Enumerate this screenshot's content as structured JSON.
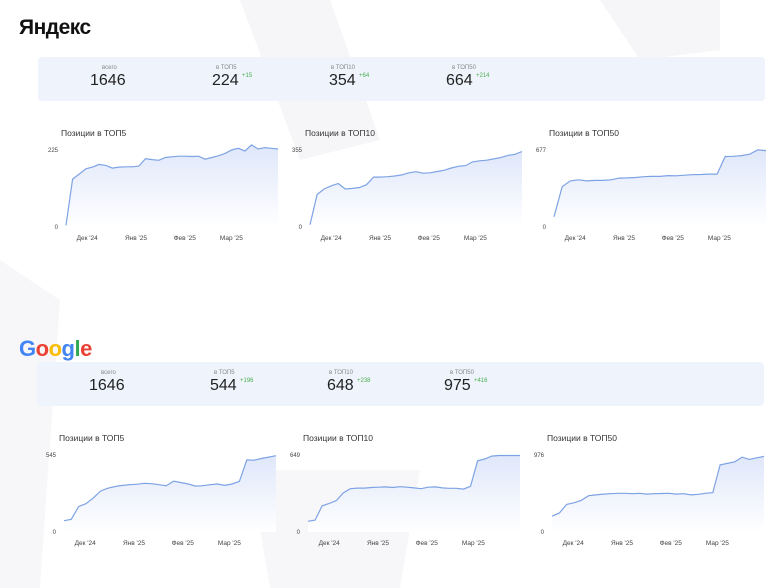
{
  "yandex": {
    "logo_text": "Яндекс",
    "stats": [
      {
        "caption": "всего",
        "value": "1646",
        "delta": ""
      },
      {
        "caption": "в ТОП5",
        "value": "224",
        "delta": "+15"
      },
      {
        "caption": "в ТОП10",
        "value": "354",
        "delta": "+64"
      },
      {
        "caption": "в ТОП50",
        "value": "664",
        "delta": "+214"
      }
    ]
  },
  "google": {
    "logo_letters": [
      {
        "char": "G",
        "color": "#4285F4"
      },
      {
        "char": "o",
        "color": "#EA4335"
      },
      {
        "char": "o",
        "color": "#FBBC05"
      },
      {
        "char": "g",
        "color": "#4285F4"
      },
      {
        "char": "l",
        "color": "#34A853"
      },
      {
        "char": "e",
        "color": "#EA4335"
      }
    ],
    "stats": [
      {
        "caption": "всего",
        "value": "1646",
        "delta": ""
      },
      {
        "caption": "в ТОП5",
        "value": "544",
        "delta": "+196"
      },
      {
        "caption": "в ТОП10",
        "value": "648",
        "delta": "+238"
      },
      {
        "caption": "в ТОП50",
        "value": "975",
        "delta": "+416"
      }
    ]
  },
  "colors": {
    "line": "#7ea3e4",
    "fill_top": "#dfe7fa",
    "fill_bottom": "#ffffff",
    "delta": "#4caf50"
  },
  "chart_data": [
    {
      "id": "yandex-top5",
      "type": "area",
      "title": "Позиции в ТОП5",
      "ylim": [
        0,
        225
      ],
      "y_ticks": [
        "0",
        "225"
      ],
      "x_ticks": [
        "Дек '24",
        "Янв '25",
        "Фев '25",
        "Мар '25"
      ],
      "x_tick_pos": [
        0.1,
        0.33,
        0.56,
        0.78
      ],
      "values": [
        5,
        140,
        155,
        170,
        175,
        183,
        180,
        172,
        175,
        176,
        176,
        178,
        200,
        197,
        195,
        203,
        205,
        207,
        207,
        206,
        207,
        198,
        203,
        208,
        215,
        225,
        230,
        222,
        240,
        228,
        232,
        230,
        228
      ]
    },
    {
      "id": "yandex-top10",
      "type": "area",
      "title": "Позиции в ТОП10",
      "ylim": [
        0,
        355
      ],
      "y_ticks": [
        "0",
        "355"
      ],
      "x_ticks": [
        "Дек '24",
        "Янв '25",
        "Фев '25",
        "Мар '25"
      ],
      "x_tick_pos": [
        0.1,
        0.33,
        0.56,
        0.78
      ],
      "values": [
        10,
        150,
        175,
        190,
        200,
        175,
        178,
        182,
        195,
        230,
        230,
        232,
        235,
        240,
        250,
        255,
        248,
        250,
        256,
        262,
        272,
        280,
        283,
        300,
        305,
        308,
        314,
        320,
        330,
        335,
        348
      ]
    },
    {
      "id": "yandex-top50",
      "type": "area",
      "title": "Позиции в ТОП50",
      "ylim": [
        0,
        677
      ],
      "y_ticks": [
        "0",
        "677"
      ],
      "x_ticks": [
        "Дек '24",
        "Янв '25",
        "Фев '25",
        "Мар '25"
      ],
      "x_tick_pos": [
        0.1,
        0.33,
        0.56,
        0.78
      ],
      "values": [
        90,
        355,
        405,
        415,
        405,
        410,
        410,
        415,
        430,
        432,
        435,
        442,
        445,
        445,
        452,
        450,
        455,
        460,
        462,
        465,
        465,
        620,
        622,
        628,
        640,
        678,
        672
      ]
    },
    {
      "id": "google-top5",
      "type": "area",
      "title": "Позиции в ТОП5",
      "ylim": [
        0,
        545
      ],
      "y_ticks": [
        "0",
        "545"
      ],
      "x_ticks": [
        "Дек '24",
        "Янв '25",
        "Фев '25",
        "Мар '25"
      ],
      "x_tick_pos": [
        0.1,
        0.33,
        0.56,
        0.78
      ],
      "values": [
        80,
        90,
        180,
        200,
        240,
        290,
        310,
        322,
        330,
        335,
        338,
        345,
        342,
        335,
        328,
        360,
        350,
        340,
        325,
        328,
        335,
        340,
        330,
        340,
        358,
        510,
        508,
        520,
        530,
        540
      ]
    },
    {
      "id": "google-top10",
      "type": "area",
      "title": "Позиции в ТОП10",
      "ylim": [
        0,
        649
      ],
      "y_ticks": [
        "0",
        "649"
      ],
      "x_ticks": [
        "Дек '24",
        "Янв '25",
        "Фев '25",
        "Мар '25"
      ],
      "x_tick_pos": [
        0.1,
        0.33,
        0.56,
        0.78
      ],
      "values": [
        90,
        100,
        220,
        240,
        265,
        330,
        365,
        370,
        370,
        375,
        378,
        380,
        375,
        382,
        378,
        372,
        365,
        378,
        380,
        372,
        368,
        368,
        362,
        385,
        600,
        615,
        640,
        645,
        645,
        645,
        645
      ]
    },
    {
      "id": "google-top50",
      "type": "area",
      "title": "Позиции в ТОП50",
      "ylim": [
        0,
        976
      ],
      "y_ticks": [
        "0",
        "976"
      ],
      "x_ticks": [
        "Дек '24",
        "Янв '25",
        "Фев '25",
        "Мар '25"
      ],
      "x_tick_pos": [
        0.1,
        0.33,
        0.56,
        0.78
      ],
      "values": [
        200,
        240,
        350,
        370,
        400,
        460,
        470,
        480,
        485,
        490,
        490,
        485,
        490,
        480,
        485,
        488,
        490,
        480,
        485,
        470,
        478,
        490,
        500,
        850,
        870,
        890,
        950,
        920,
        940,
        958
      ]
    }
  ]
}
